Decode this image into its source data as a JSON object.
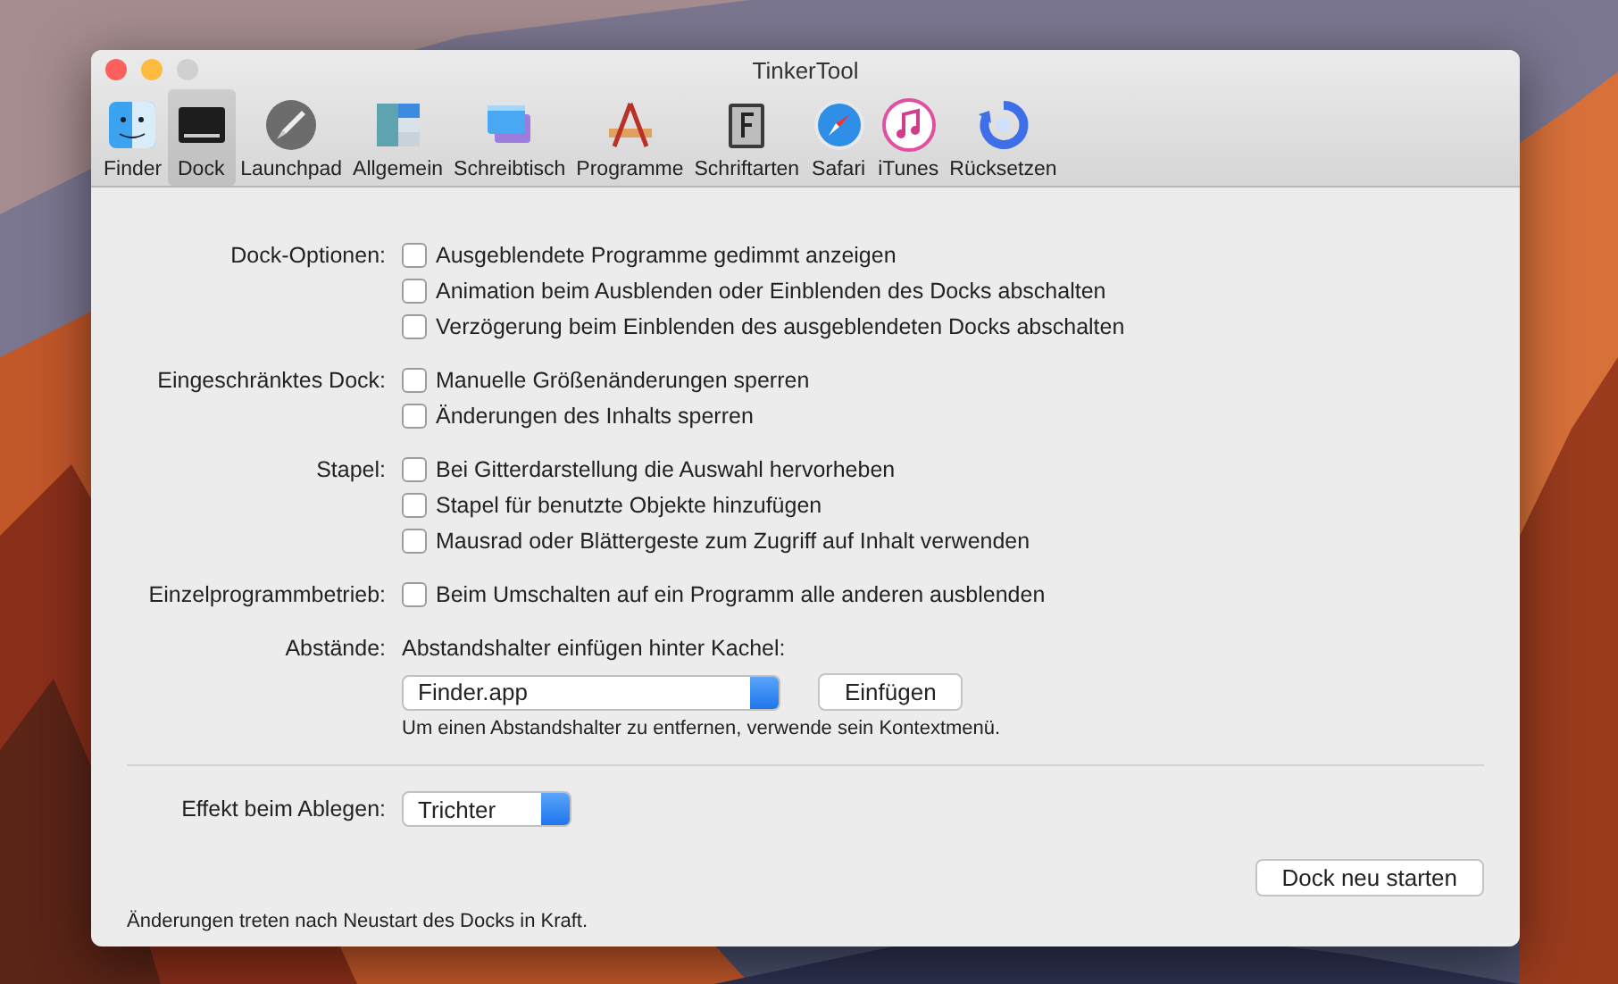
{
  "window": {
    "title": "TinkerTool"
  },
  "toolbar": {
    "items": [
      {
        "label": "Finder",
        "selected": false
      },
      {
        "label": "Dock",
        "selected": true
      },
      {
        "label": "Launchpad",
        "selected": false
      },
      {
        "label": "Allgemein",
        "selected": false
      },
      {
        "label": "Schreibtisch",
        "selected": false
      },
      {
        "label": "Programme",
        "selected": false
      },
      {
        "label": "Schriftarten",
        "selected": false
      },
      {
        "label": "Safari",
        "selected": false
      },
      {
        "label": "iTunes",
        "selected": false
      },
      {
        "label": "Rücksetzen",
        "selected": false
      }
    ]
  },
  "groups": [
    {
      "label": "Dock-Optionen:",
      "options": [
        {
          "label": "Ausgeblendete Programme gedimmt anzeigen",
          "checked": false
        },
        {
          "label": "Animation beim Ausblenden oder Einblenden des Docks abschalten",
          "checked": false
        },
        {
          "label": "Verzögerung beim Einblenden des ausgeblendeten Docks abschalten",
          "checked": false
        }
      ]
    },
    {
      "label": "Eingeschränktes Dock:",
      "options": [
        {
          "label": "Manuelle Größenänderungen sperren",
          "checked": false
        },
        {
          "label": "Änderungen des Inhalts sperren",
          "checked": false
        }
      ]
    },
    {
      "label": "Stapel:",
      "options": [
        {
          "label": "Bei Gitterdarstellung die Auswahl hervorheben",
          "checked": false
        },
        {
          "label": "Stapel für benutzte Objekte hinzufügen",
          "checked": false
        },
        {
          "label": "Mausrad oder Blättergeste zum Zugriff auf Inhalt verwenden",
          "checked": false
        }
      ]
    },
    {
      "label": "Einzelprogrammbetrieb:",
      "options": [
        {
          "label": "Beim Umschalten auf ein Programm alle anderen ausblenden",
          "checked": false
        }
      ]
    }
  ],
  "spacers": {
    "label": "Abstände:",
    "prompt": "Abstandshalter einfügen hinter Kachel:",
    "popup": "Finder.app",
    "button": "Einfügen",
    "hint": "Um einen Abstandshalter zu entfernen, verwende sein Kontextmenü."
  },
  "effect": {
    "label": "Effekt beim Ablegen:",
    "popup": "Trichter"
  },
  "footer": {
    "note": "Änderungen treten nach Neustart des Docks in Kraft.",
    "button": "Dock neu starten"
  }
}
